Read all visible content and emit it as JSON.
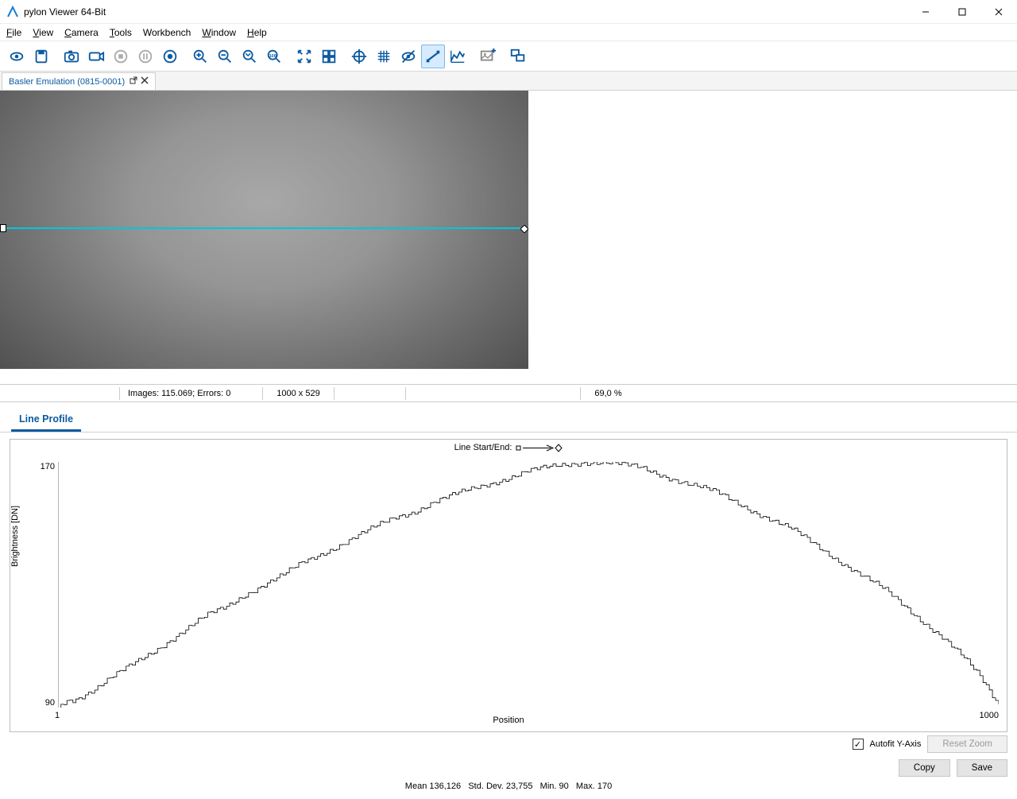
{
  "window": {
    "title": "pylon Viewer 64-Bit"
  },
  "menu": {
    "file": "File",
    "view": "View",
    "camera": "Camera",
    "tools": "Tools",
    "workbench": "Workbench",
    "window": "Window",
    "help": "Help"
  },
  "tab": {
    "label": "Basler Emulation (0815-0001)"
  },
  "status": {
    "images_label": "Images: 115.069; Errors: 0",
    "resolution": "1000 x 529",
    "zoom": "69,0 %"
  },
  "panel": {
    "title": "Line Profile"
  },
  "chart_legend": {
    "label": "Line Start/End:"
  },
  "chart_controls": {
    "autofit_label": "Autofit Y-Axis",
    "autofit_checked": true,
    "reset_zoom": "Reset Zoom",
    "copy": "Copy",
    "save": "Save"
  },
  "chart_stats": {
    "mean_label": "Mean",
    "mean": "136,126",
    "std_label": "Std. Dev.",
    "std": "23,755",
    "min_label": "Min.",
    "min": "90",
    "max_label": "Max.",
    "max": "170"
  },
  "chart_data": {
    "type": "line",
    "title": "",
    "xlabel": "Position",
    "ylabel": "Brightness [DN]",
    "xlim": [
      1,
      1000
    ],
    "ylim": [
      90,
      170
    ],
    "x_ticks": [
      1,
      1000
    ],
    "y_ticks": [
      90,
      170
    ],
    "x": [
      1,
      20,
      40,
      60,
      80,
      100,
      120,
      140,
      160,
      180,
      200,
      220,
      240,
      260,
      280,
      300,
      320,
      340,
      360,
      380,
      400,
      420,
      440,
      460,
      480,
      500,
      520,
      540,
      560,
      580,
      600,
      620,
      640,
      660,
      680,
      700,
      720,
      740,
      760,
      780,
      800,
      820,
      840,
      860,
      880,
      900,
      920,
      940,
      960,
      980,
      1000
    ],
    "values": [
      90,
      93,
      96,
      100,
      104,
      108,
      112,
      116,
      120,
      123,
      127,
      130,
      133,
      137,
      140,
      143,
      146,
      149,
      152,
      154,
      157,
      159,
      161,
      163,
      165,
      167,
      168,
      169,
      170,
      170,
      169,
      168,
      166,
      164,
      162,
      160,
      157,
      154,
      151,
      148,
      144,
      140,
      136,
      132,
      128,
      123,
      118,
      113,
      107,
      100,
      91
    ]
  }
}
